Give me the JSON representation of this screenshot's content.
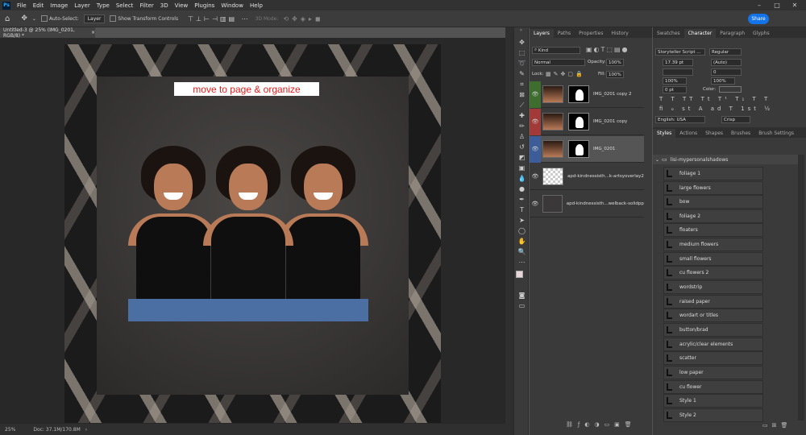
{
  "menubar": {
    "logo": "Ps",
    "items": [
      "File",
      "Edit",
      "Image",
      "Layer",
      "Type",
      "Select",
      "Filter",
      "3D",
      "View",
      "Plugins",
      "Window",
      "Help"
    ]
  },
  "options": {
    "auto_select_label": "Auto-Select:",
    "auto_select_value": "Layer",
    "transform_controls_label": "Show Transform Controls",
    "mode_label": "3D Mode:",
    "share_label": "Share"
  },
  "document": {
    "tab_title": "Untitled-3 @ 25% (IMG_0201, RGB/8) *",
    "overlay_text": "move to page & organize",
    "zoom": "25%",
    "doc_info": "Doc: 37.1M/170.8M"
  },
  "layers_panel": {
    "tabs": [
      "Layers",
      "Paths",
      "Properties",
      "History"
    ],
    "kind_label": "Kind",
    "blend_mode": "Normal",
    "opacity_label": "Opacity:",
    "opacity_value": "100%",
    "lock_label": "Lock:",
    "fill_label": "Fill:",
    "fill_value": "100%",
    "layers": [
      {
        "name": "IMG_0201 copy 2",
        "color": "#3d6e2e"
      },
      {
        "name": "IMG_0201 copy",
        "color": "#a23a38"
      },
      {
        "name": "IMG_0201",
        "color": "#3c5d9a"
      },
      {
        "name": "apd-kindnessisth...k-artsyoverlay2",
        "color": "#3a3a3a"
      },
      {
        "name": "apd-kindnessisth...welback-solidpp1",
        "color": "#3a3a3a"
      }
    ]
  },
  "character_panel": {
    "tabs": [
      "Swatches",
      "Character",
      "Paragraph",
      "Glyphs"
    ],
    "font_family": "Storyteller Script ...",
    "font_style": "Regular",
    "font_size": "17.39 pt",
    "leading": "(Auto)",
    "kerning": "",
    "tracking": "0",
    "vertical_scale": "100%",
    "horizontal_scale": "100%",
    "baseline": "0 pt",
    "color_label": "Color:",
    "language": "English: USA",
    "antialias": "Crisp"
  },
  "styles_panel": {
    "tabs": [
      "Styles",
      "Actions",
      "Shapes",
      "Brushes",
      "Brush Settings"
    ],
    "group_name": "lisi-mypersonalshadows",
    "items": [
      "foliage 1",
      "large flowers",
      "bow",
      "foliage 2",
      "floaters",
      "medium flowers",
      "small flowers",
      "cu flowers 2",
      "wordstrip",
      "raised paper",
      "wordart or titles",
      "button/brad",
      "acrylic/clear elements",
      "scatter",
      "low paper",
      "cu flower",
      "Style 1",
      "Style 2"
    ]
  },
  "colors": {
    "accent": "#1473e6",
    "overlay_text": "#e31c1c"
  }
}
